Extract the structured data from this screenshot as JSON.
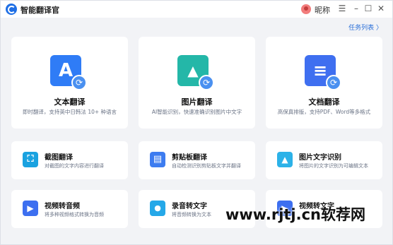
{
  "app": {
    "title": "智能翻译官",
    "nickname": "昵称"
  },
  "window_controls": {
    "menu": "☰",
    "minimize": "–",
    "maximize": "☐",
    "close": "✕"
  },
  "header": {
    "task_list": "任务列表 〉"
  },
  "big_cards": [
    {
      "title": "文本翻译",
      "desc": "即时翻译，支持英中日韩法 10+ 种语言",
      "icon_glyph": "A",
      "color": "#2f7cf6"
    },
    {
      "title": "图片翻译",
      "desc": "AI智能识别，快速准确识别图片中文字",
      "icon_glyph": "▲",
      "color": "#24b7a8"
    },
    {
      "title": "文档翻译",
      "desc": "高保真排版，支持PDF、Word等多格式",
      "icon_glyph": "≡",
      "color": "#3f6ff0"
    }
  ],
  "small_cards": [
    {
      "title": "截图翻译",
      "desc": "对截图的文字内容进行翻译",
      "icon_glyph": "⛶",
      "color": "#1aa2e0"
    },
    {
      "title": "剪贴板翻译",
      "desc": "自动检测识别剪贴板文字并翻译",
      "icon_glyph": "▤",
      "color": "#3d7cf0"
    },
    {
      "title": "图片文字识别",
      "desc": "将图片的文字识别为可编辑文本",
      "icon_glyph": "▲",
      "color": "#2cb2e8"
    },
    {
      "title": "视频转音频",
      "desc": "将多种视频格式转换为音频",
      "icon_glyph": "▶",
      "color": "#3d6ff0"
    },
    {
      "title": "录音转文字",
      "desc": "将音频转换为文本",
      "icon_glyph": "●",
      "color": "#25a8e8"
    },
    {
      "title": "视频转文字",
      "desc": "",
      "icon_glyph": "▶",
      "color": "#3d6ff0"
    }
  ],
  "watermark": "www.rjtj.cn软荐网"
}
